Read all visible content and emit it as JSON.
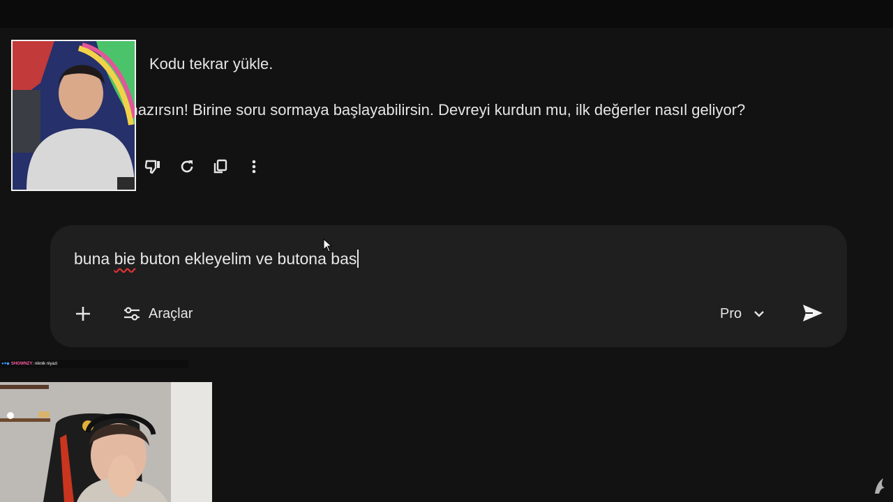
{
  "conversation": {
    "messages": [
      "Kodu tekrar yükle.",
      "ndi hazırsın! Birine soru sormaya başlayabilirsin. Devreyi kurdun mu, ilk değerler nasıl geliyor?"
    ],
    "actions": [
      "thumbs-down-icon",
      "refresh-icon",
      "copy-icon",
      "more-vert-icon"
    ]
  },
  "composer": {
    "input_before": "buna ",
    "input_misspelled": "bie",
    "input_after": " buton ekleyelim ve butona bas",
    "tools_label": "Araçlar",
    "model_label": "Pro",
    "icons": {
      "add": "plus-icon",
      "tools": "sliders-icon",
      "model": "chevron-down-icon",
      "send": "send-icon"
    }
  },
  "stream_overlay": {
    "chat_user": "SHOWNZY",
    "chat_text": ": niknik niyazi"
  },
  "colors": {
    "background": "#121212",
    "composer_bg": "#1f1f20",
    "text": "#e8e8e8",
    "chat_user": "#ff5fa2"
  }
}
